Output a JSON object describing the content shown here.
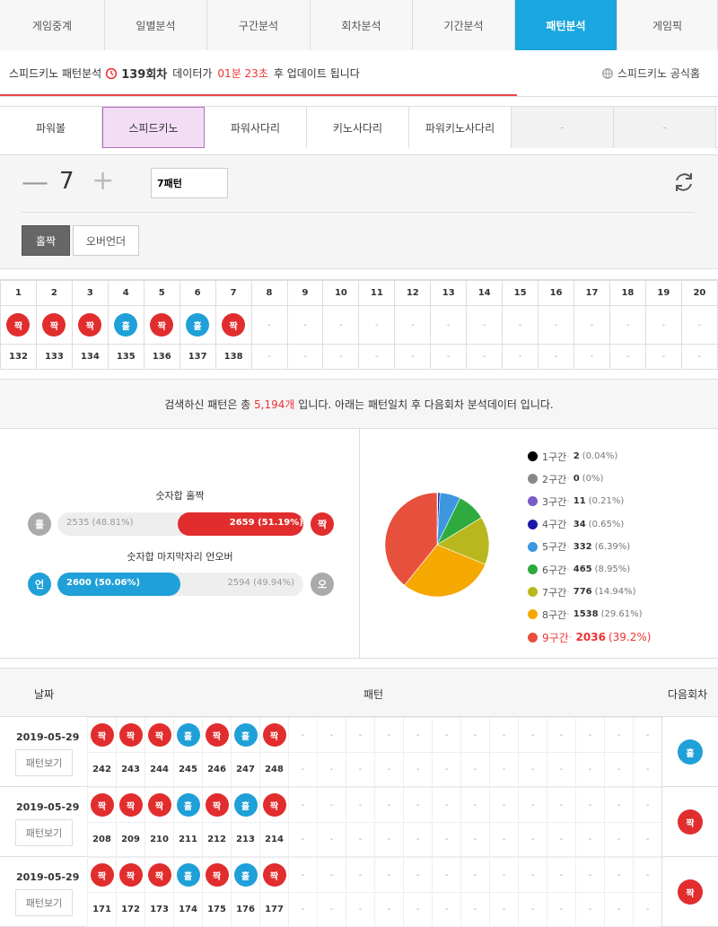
{
  "topnav": {
    "tabs": [
      {
        "label": "게임중계",
        "active": false
      },
      {
        "label": "일별분석",
        "active": false
      },
      {
        "label": "구간분석",
        "active": false
      },
      {
        "label": "회차분석",
        "active": false
      },
      {
        "label": "기간분석",
        "active": false
      },
      {
        "label": "패턴분석",
        "active": true
      },
      {
        "label": "게임픽",
        "active": false
      }
    ]
  },
  "infobar": {
    "title": "스피드키노 패턴분석",
    "round": "139회차",
    "text_mid": "데이터가",
    "countdown": "01분 23초",
    "text_end": "후 업데이트 됩니다",
    "homepage_label": "스피드키노 공식홈"
  },
  "gametabs": [
    "파워볼",
    "스피드키노",
    "파워사다리",
    "키노사다리",
    "파워키노사다리",
    "-",
    "-"
  ],
  "control": {
    "count": "7",
    "pattern_value": "7패턴",
    "type_buttons": [
      "홀짝",
      "오버언더"
    ]
  },
  "sequence": {
    "columns": [
      "1",
      "2",
      "3",
      "4",
      "5",
      "6",
      "7",
      "8",
      "9",
      "10",
      "11",
      "12",
      "13",
      "14",
      "15",
      "16",
      "17",
      "18",
      "19",
      "20"
    ],
    "balls": [
      "짝",
      "짝",
      "짝",
      "홀",
      "짝",
      "홀",
      "짝",
      "-",
      "-",
      "-",
      "-",
      "-",
      "-",
      "-",
      "-",
      "-",
      "-",
      "-",
      "-",
      "-"
    ],
    "rounds": [
      "132",
      "133",
      "134",
      "135",
      "136",
      "137",
      "138",
      "-",
      "-",
      "-",
      "-",
      "-",
      "-",
      "-",
      "-",
      "-",
      "-",
      "-",
      "-",
      "-"
    ],
    "empty": "-"
  },
  "summary": {
    "prefix": "검색하신 패턴은 총",
    "count": "5,194개",
    "suffix": "입니다. 아래는 패턴일치 후 다음회차 분석데이터 입니다."
  },
  "oddeven": {
    "title": "숫자합 홀짝",
    "left_ball": "홀",
    "right_ball": "짝",
    "left_text": "2535 (48.81%)",
    "right_text": "2659 (51.19%)",
    "right_fraction": 0.5119
  },
  "overunder": {
    "title": "숫자합 마지막자리 언오버",
    "left_ball": "언",
    "right_ball": "오",
    "left_text": "2600 (50.06%)",
    "right_text": "2594 (49.94%)",
    "left_fraction": 0.5006
  },
  "chart_data": {
    "type": "pie",
    "categories": [
      "1구간",
      "2구간",
      "3구간",
      "4구간",
      "5구간",
      "6구간",
      "7구간",
      "8구간",
      "9구간"
    ],
    "values": [
      2,
      0,
      11,
      34,
      332,
      465,
      776,
      1538,
      2036
    ],
    "percent_labels": [
      "(0.04%)",
      "(0%)",
      "(0.21%)",
      "(0.65%)",
      "(6.39%)",
      "(8.95%)",
      "(14.94%)",
      "(29.61%)",
      "(39.2%)"
    ],
    "colors": [
      "#000000",
      "#888888",
      "#7a5cc8",
      "#1a1aa8",
      "#3c96e0",
      "#2eaa3e",
      "#b8b81e",
      "#f5a800",
      "#e6503c"
    ],
    "highlight_index": 8,
    "legend_placement": "right"
  },
  "results": {
    "header": {
      "date": "날짜",
      "pattern": "패턴",
      "next": "다음회차"
    },
    "view_label": "패턴보기",
    "rows": [
      {
        "date": "2019-05-29",
        "balls": [
          "짝",
          "짝",
          "짝",
          "홀",
          "짝",
          "홀",
          "짝"
        ],
        "rounds": [
          "242",
          "243",
          "244",
          "245",
          "246",
          "247",
          "248"
        ],
        "next": "홀"
      },
      {
        "date": "2019-05-29",
        "balls": [
          "짝",
          "짝",
          "짝",
          "홀",
          "짝",
          "홀",
          "짝"
        ],
        "rounds": [
          "208",
          "209",
          "210",
          "211",
          "212",
          "213",
          "214"
        ],
        "next": "짝"
      },
      {
        "date": "2019-05-29",
        "balls": [
          "짝",
          "짝",
          "짝",
          "홀",
          "짝",
          "홀",
          "짝"
        ],
        "rounds": [
          "171",
          "172",
          "173",
          "174",
          "175",
          "176",
          "177"
        ],
        "next": "짝"
      }
    ],
    "empty": "-"
  }
}
